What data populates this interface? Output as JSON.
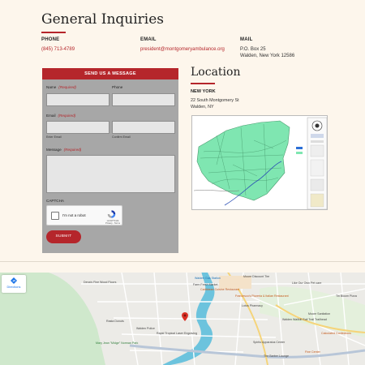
{
  "page": {
    "title": "General Inquiries"
  },
  "contact": {
    "phone": {
      "label": "PHONE",
      "value": "(845) 713-4789"
    },
    "email": {
      "label": "EMAIL",
      "value": "president@montgomeryambulance.org"
    },
    "mail": {
      "label": "MAIL",
      "line1": "P.O. Box 25",
      "line2": "Walden, New York 12586"
    }
  },
  "form": {
    "header": "SEND US A MESSAGE",
    "required": "(Required)",
    "name_label": "Name",
    "phone_label": "Phone",
    "email_label": "Email",
    "enter_email": "Enter Email",
    "confirm_email": "Confirm Email",
    "message_label": "Message",
    "captcha_label": "CAPTCHA",
    "captcha_text": "I'm not a robot",
    "captcha_brand": "reCAPTCHA",
    "captcha_links": "Privacy - Terms",
    "submit": "SUBMIT"
  },
  "location": {
    "title": "Location",
    "label": "NEW YORK",
    "line1": "22 South Montgomery St",
    "line2": "Walden, NY"
  },
  "map": {
    "directions": "Directions",
    "labels": [
      "Dena's Fine Wood Floors",
      "Walden Gas Station",
      "Moore Discount Tire",
      "Farm Fresh Market",
      "Caribbean Cuisine Restaurant",
      "Francesco's Pizzeria & Italian Restaurant",
      "Lotus Pharmacy",
      "Like Our Own Pet care",
      "Tin Bloom Pizza",
      "Walden Wallkill Rail Trail Trailhead",
      "Moore Sanitation",
      "Calculated Confections",
      "Walden Police",
      "Rasta Donuts",
      "Rapid Tropical Laser Engraving",
      "Mary Jean \"Midge\" Norman Park",
      "Spirito Apparatus Center",
      "Fine Center",
      "The Barber Lounge"
    ]
  },
  "colors": {
    "accent": "#b5262b",
    "background": "#fdf6ec",
    "form_bg": "#a7a7a7"
  }
}
